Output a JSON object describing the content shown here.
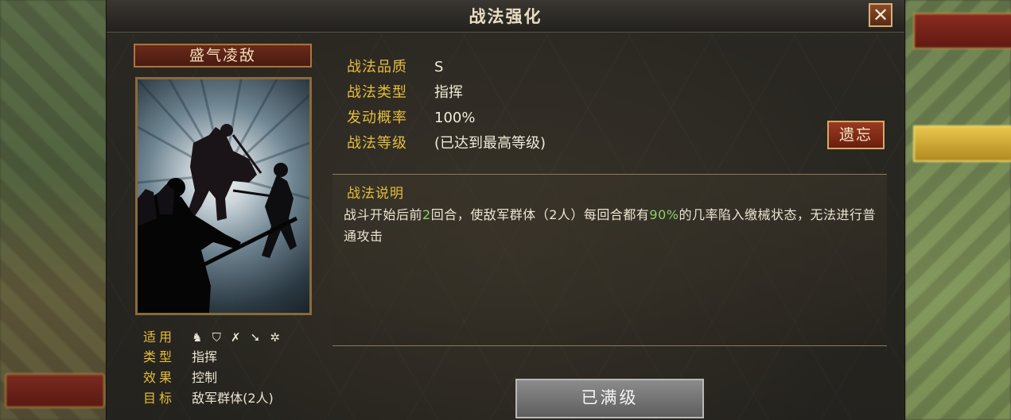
{
  "dialog": {
    "title": "战法强化",
    "close_icon": "close-icon"
  },
  "skill": {
    "name": "盛气凌敌",
    "info": [
      {
        "key": "适用",
        "type": "icons"
      },
      {
        "key": "类型",
        "value": "指挥"
      },
      {
        "key": "效果",
        "value": "控制"
      },
      {
        "key": "目标",
        "value": "敌军群体(2人)"
      }
    ],
    "troop_icons": [
      "cavalry-icon",
      "shield-icon",
      "bow-icon",
      "spear-icon",
      "siege-icon"
    ]
  },
  "attributes": [
    {
      "key": "战法品质",
      "value": "S"
    },
    {
      "key": "战法类型",
      "value": "指挥"
    },
    {
      "key": "发动概率",
      "value": "100%"
    },
    {
      "key": "战法等级",
      "value": "(已达到最高等级)"
    }
  ],
  "forget_button": "遗忘",
  "description": {
    "title": "战法说明",
    "part1": "战斗开始后前",
    "rounds": "2",
    "part2": "回合，使敌军群体（2人）每回合都有",
    "chance": "90%",
    "part3": "的几率陷入缴械状态，无法进行普通攻击"
  },
  "maxed_button": "已满级",
  "colors": {
    "label_gold": "#e6bd3c",
    "highlight_green": "#8ad06a",
    "panel_bg": "#2a2823"
  }
}
